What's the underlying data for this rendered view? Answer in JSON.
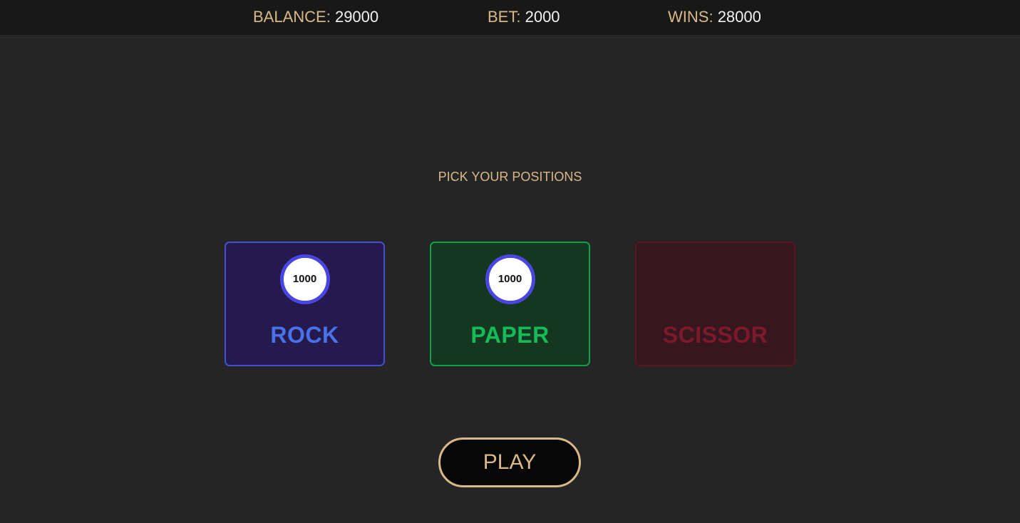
{
  "header": {
    "balance_label": "BALANCE:",
    "balance_value": "29000",
    "bet_label": "BET:",
    "bet_value": "2000",
    "wins_label": "WINS:",
    "wins_value": "28000"
  },
  "prompt": "PICK YOUR POSITIONS",
  "positions": [
    {
      "label": "ROCK",
      "chip": "1000",
      "color": "#4a72e8",
      "selected": true
    },
    {
      "label": "PAPER",
      "chip": "1000",
      "color": "#14bb58",
      "selected": true
    },
    {
      "label": "SCISSOR",
      "chip": null,
      "color": "#7c1a2c",
      "selected": false
    }
  ],
  "play_label": "PLAY",
  "colors": {
    "accent": "#d8b987",
    "background": "#252525",
    "chip_ring": "#4a46e0"
  }
}
